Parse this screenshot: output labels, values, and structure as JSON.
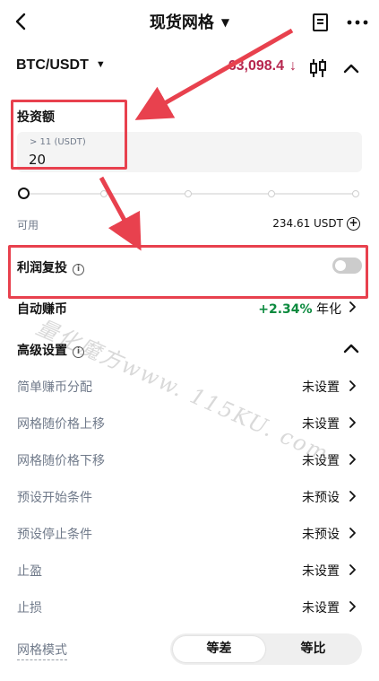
{
  "header": {
    "title": "现货网格",
    "back_icon": "chevron-left-icon",
    "doc_icon": "document-icon",
    "more_icon": "more-dots-icon"
  },
  "pair": {
    "symbol": "BTC/USDT",
    "price": "63,098.4",
    "price_arrow": "↓",
    "price_color": "#b6264e"
  },
  "investment": {
    "label": "投资额",
    "hint": "> 11 (USDT)",
    "value": "20"
  },
  "slider": {
    "level": 0
  },
  "available": {
    "label": "可用",
    "value": "234.61 USDT"
  },
  "compound": {
    "label": "利润复投",
    "enabled": false
  },
  "auto_earn": {
    "label": "自动赚币",
    "rate": "+2.34%",
    "suffix": "年化",
    "rate_color": "#0b8a3e"
  },
  "advanced": {
    "label": "高级设置",
    "items": [
      {
        "label": "简单赚币分配",
        "value": "未设置"
      },
      {
        "label": "网格随价格上移",
        "value": "未设置"
      },
      {
        "label": "网格随价格下移",
        "value": "未设置"
      },
      {
        "label": "预设开始条件",
        "value": "未预设"
      },
      {
        "label": "预设停止条件",
        "value": "未预设"
      },
      {
        "label": "止盈",
        "value": "未设置"
      },
      {
        "label": "止损",
        "value": "未设置"
      }
    ]
  },
  "grid_mode": {
    "label": "网格模式",
    "options": [
      "等差",
      "等比"
    ],
    "selected": "等差"
  },
  "watermark": "量化魔方www. 115KU. com"
}
